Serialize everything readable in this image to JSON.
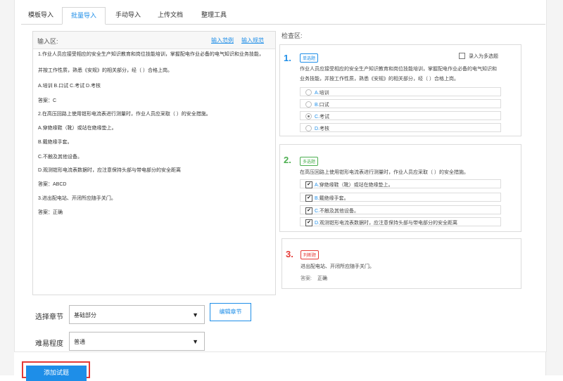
{
  "tabs": [
    {
      "label": "模板导入"
    },
    {
      "label": "批量导入"
    },
    {
      "label": "手动导入"
    },
    {
      "label": "上传文档"
    },
    {
      "label": "整理工具"
    }
  ],
  "input_panel": {
    "title": "输入区:",
    "example_link": "输入范例",
    "rules_link": "输入规范",
    "lines": [
      "1.作业人员应接受相应的安全生产知识教育和岗位技能培训，掌握配电作业必备的电气知识和业务技能，",
      "并按工作性质，熟悉《安规》的相关部分，经（ ）合格上岗。",
      "A.培训 B.口试 C.考试 D.考核",
      "答案：C",
      "2.在高压回路上使用钳形电流表进行测量时，作业人员应采取（     ）的安全措施。",
      "A.穿绝缘鞋（靴）或站在绝缘垫上。",
      "B.戴绝缘手套。",
      "C.不触及其他设备。",
      "D.观测钳形电流表数据时，应注意保持头部与带电部分的安全距离",
      "答案：ABCD",
      "3.进出配电站、开闭所应随手关门。",
      "答案：正确"
    ]
  },
  "check_panel": {
    "title": "检查区:",
    "q1": {
      "number": "1.",
      "type": "单选题",
      "multi_label": "录入为多选题",
      "text_line1": "作业人员应接受相应的安全生产知识教育和岗位技能培训，掌握配电作业必备的电气知识和",
      "text_line2": "业务技能，并按工作性质，熟悉《安规》的相关部分，经（ ）合格上岗。",
      "options": [
        {
          "letter": "A.",
          "text": "培训",
          "selected": false
        },
        {
          "letter": "B.",
          "text": "口试",
          "selected": false
        },
        {
          "letter": "C.",
          "text": "考试",
          "selected": true
        },
        {
          "letter": "D.",
          "text": "考核",
          "selected": false
        }
      ]
    },
    "q2": {
      "number": "2.",
      "type": "多选题",
      "text": "在高压回路上使用钳形电流表进行测量时，作业人员应采取（     ）的安全措施。",
      "options": [
        {
          "letter": "A.",
          "text": "穿绝缘鞋（靴）或站在绝缘垫上。",
          "checked": true
        },
        {
          "letter": "B.",
          "text": "戴绝缘手套。",
          "checked": true
        },
        {
          "letter": "C.",
          "text": "不触及其他设备。",
          "checked": true
        },
        {
          "letter": "D.",
          "text": "观测钳形电流表数据时，应注意保持头部与带电部分的安全距离",
          "checked": true
        }
      ]
    },
    "q3": {
      "number": "3.",
      "type": "判断题",
      "text": "进出配电站、开闭所应随手关门。",
      "answer_label": "答案:",
      "answer_value": "正确"
    }
  },
  "form": {
    "chapter_label": "选择章节",
    "chapter_value": "基础部分",
    "edit_chapter_button": "编辑章节",
    "difficulty_label": "难易程度",
    "difficulty_value": "普通",
    "caret": "▼"
  },
  "add_button": "添加试题",
  "colors": {
    "accent": "#1e8ee8",
    "single": "#1e8ee8",
    "multi": "#4caf50",
    "judge": "#e53935"
  }
}
